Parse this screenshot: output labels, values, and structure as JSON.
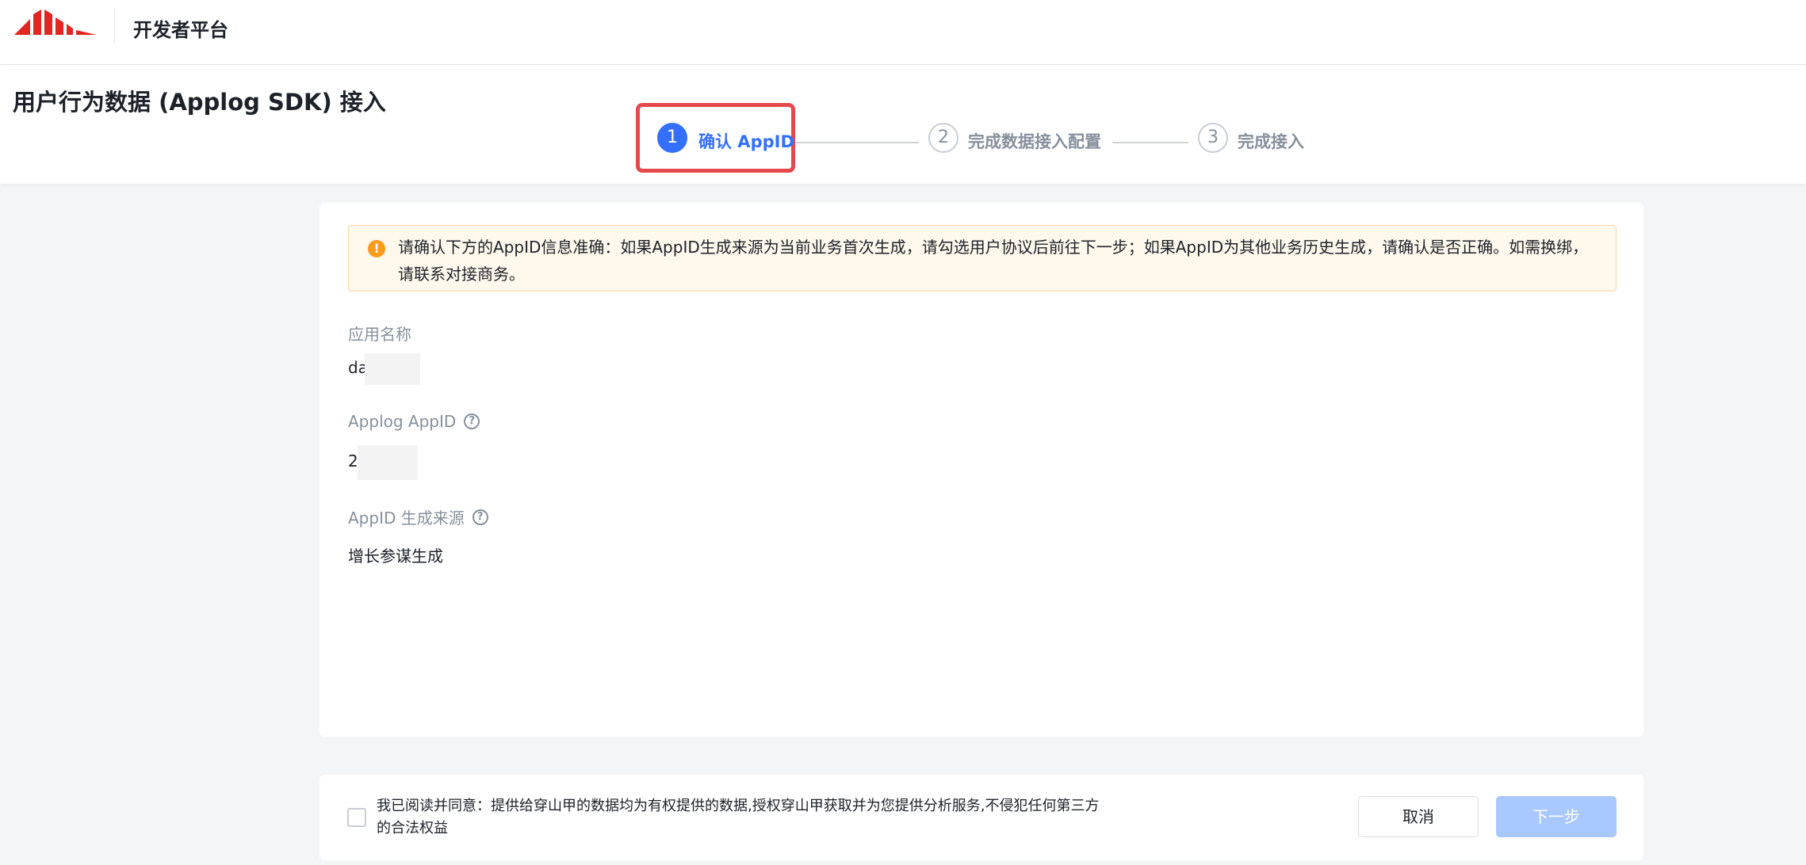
{
  "topbar": {
    "platform_name": "开发者平台",
    "logo_icon": "brand-logo-icon",
    "brand_color": "#e3261f"
  },
  "header": {
    "title": "用户行为数据 (Applog SDK) 接入",
    "steps": [
      {
        "number": "1",
        "label": "确认 AppID",
        "state": "active"
      },
      {
        "number": "2",
        "label": "完成数据接入配置",
        "state": "inactive"
      },
      {
        "number": "3",
        "label": "完成接入",
        "state": "inactive"
      }
    ],
    "highlight_color": "#e5484d",
    "accent_color": "#3370ff"
  },
  "alert": {
    "icon": "warning-icon",
    "icon_glyph": "!",
    "text": "请确认下方的AppID信息准确：如果AppID生成来源为当前业务首次生成，请勾选用户协议后前往下一步；如果AppID为其他业务历史生成，请确认是否正确。如需换绑，请联系对接商务。"
  },
  "fields": [
    {
      "label": "应用名称",
      "value": "da",
      "help": false
    },
    {
      "label": "Applog AppID",
      "value": "2",
      "help": true
    },
    {
      "label": "AppID 生成来源",
      "value": "增长参谋生成",
      "help": true
    }
  ],
  "footer": {
    "agreement": "我已阅读并同意：提供给穿山甲的数据均为有权提供的数据,授权穿山甲获取并为您提供分析服务,不侵犯任何第三方的合法权益",
    "cancel_label": "取消",
    "next_label": "下一步"
  }
}
